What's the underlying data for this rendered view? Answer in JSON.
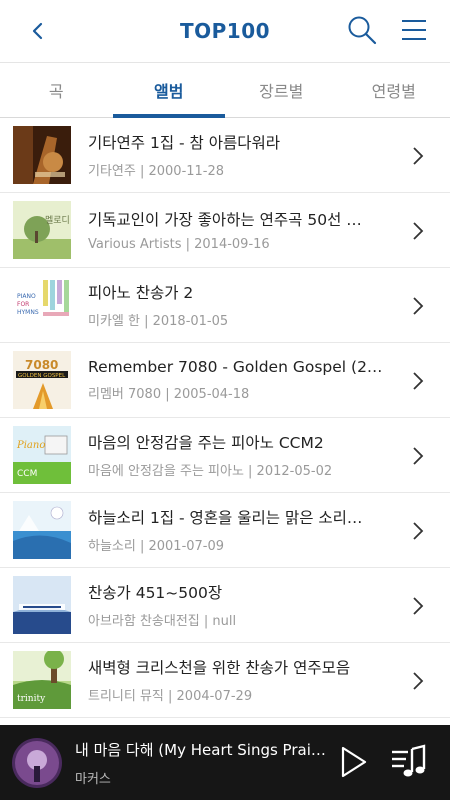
{
  "header": {
    "title": "TOP100"
  },
  "tabs": [
    {
      "label": "곡",
      "active": false
    },
    {
      "label": "앨범",
      "active": true
    },
    {
      "label": "장르별",
      "active": false
    },
    {
      "label": "연령별",
      "active": false
    }
  ],
  "albums": [
    {
      "title": "기타연주 1집 - 참 아름다워라",
      "subtitle": "기타연주 | 2000-11-28"
    },
    {
      "title": "기독교인이 가장 좋아하는 연주곡 50선 …",
      "subtitle": "Various Artists | 2014-09-16"
    },
    {
      "title": "피아노 찬송가 2",
      "subtitle": "미카엘 한 | 2018-01-05"
    },
    {
      "title": "Remember 7080 - Golden Gospel (2…",
      "subtitle": "리멤버 7080 | 2005-04-18"
    },
    {
      "title": "마음의 안정감을 주는 피아노 CCM2",
      "subtitle": "마음에 안정감을 주는 피아노 | 2012-05-02"
    },
    {
      "title": "하늘소리 1집 - 영혼을 울리는 맑은 소리…",
      "subtitle": "하늘소리 | 2001-07-09"
    },
    {
      "title": "찬송가 451~500장",
      "subtitle": "아브라함 찬송대전집 | null"
    },
    {
      "title": "새벽형 크리스천을 위한 찬송가 연주모음",
      "subtitle": "트리니티 뮤직 | 2004-07-29"
    }
  ],
  "player": {
    "title": "내 마음 다해 (My Heart Sings Prai…",
    "artist": "마커스"
  },
  "colors": {
    "accent": "#1a5b9c",
    "player_bg": "#161616"
  }
}
